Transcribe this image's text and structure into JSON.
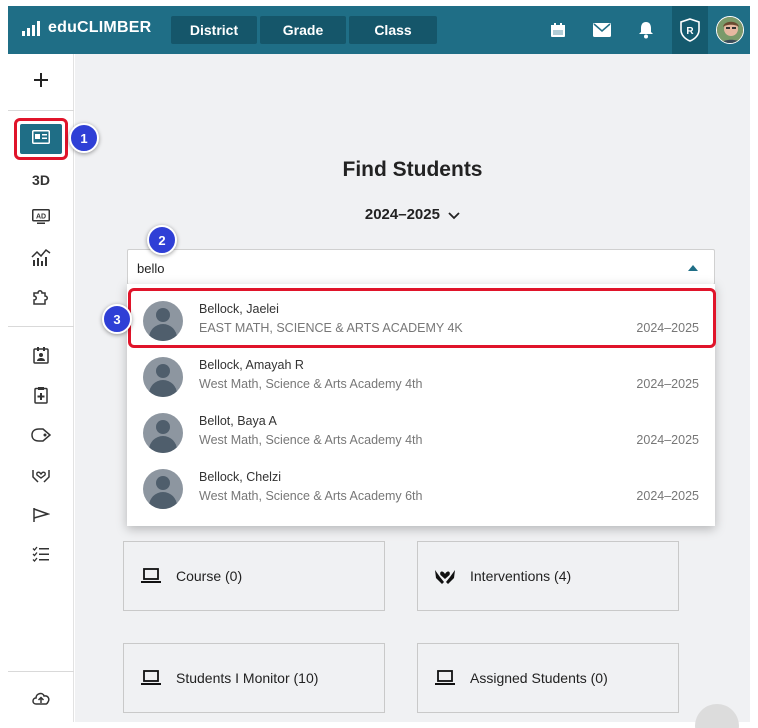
{
  "app": {
    "name": "eduCLIMBER"
  },
  "nav": {
    "tabs": [
      {
        "label": "District"
      },
      {
        "label": "Grade"
      },
      {
        "label": "Class"
      }
    ]
  },
  "topbar_icons": [
    "calendar-icon",
    "mail-icon",
    "bell-icon",
    "shield-r-icon",
    "user-avatar"
  ],
  "sidebar": {
    "items": [
      {
        "icon": "plus-icon"
      },
      {
        "icon": "student-card-icon",
        "active": true
      },
      {
        "label": "3D"
      },
      {
        "icon": "ad-icon"
      },
      {
        "icon": "analytics-icon"
      },
      {
        "icon": "puzzle-icon"
      },
      {
        "icon": "calendar-person-icon"
      },
      {
        "icon": "clipboard-icon"
      },
      {
        "icon": "tag-icon"
      },
      {
        "icon": "hands-heart-icon"
      },
      {
        "icon": "flag-icon"
      },
      {
        "icon": "checklist-icon"
      },
      {
        "icon": "cloud-upload-icon"
      }
    ]
  },
  "main": {
    "title": "Find Students",
    "year_selector": "2024–2025",
    "search": {
      "value": "bello"
    },
    "results": [
      {
        "name": "Bellock, Jaelei",
        "school": "EAST MATH, SCIENCE & ARTS ACADEMY 4K",
        "year": "2024–2025"
      },
      {
        "name": "Bellock, Amayah R",
        "school": "West Math, Science & Arts Academy 4th",
        "year": "2024–2025"
      },
      {
        "name": "Bellot, Baya A",
        "school": "West Math, Science & Arts Academy 4th",
        "year": "2024–2025"
      },
      {
        "name": "Bellock, Chelzi",
        "school": "West Math, Science & Arts Academy 6th",
        "year": "2024–2025"
      }
    ],
    "cards": [
      {
        "label": "Course (0)",
        "icon": "laptop-icon"
      },
      {
        "label": "Interventions (4)",
        "icon": "hands-heart-icon"
      },
      {
        "label": "Students I Monitor (10)",
        "icon": "laptop-icon"
      },
      {
        "label": "Assigned Students (0)",
        "icon": "laptop-icon"
      }
    ]
  },
  "callouts": [
    "1",
    "2",
    "3"
  ],
  "colors": {
    "brand": "#1f6e86",
    "highlight": "#e0142a",
    "callout": "#2f3fd6"
  }
}
